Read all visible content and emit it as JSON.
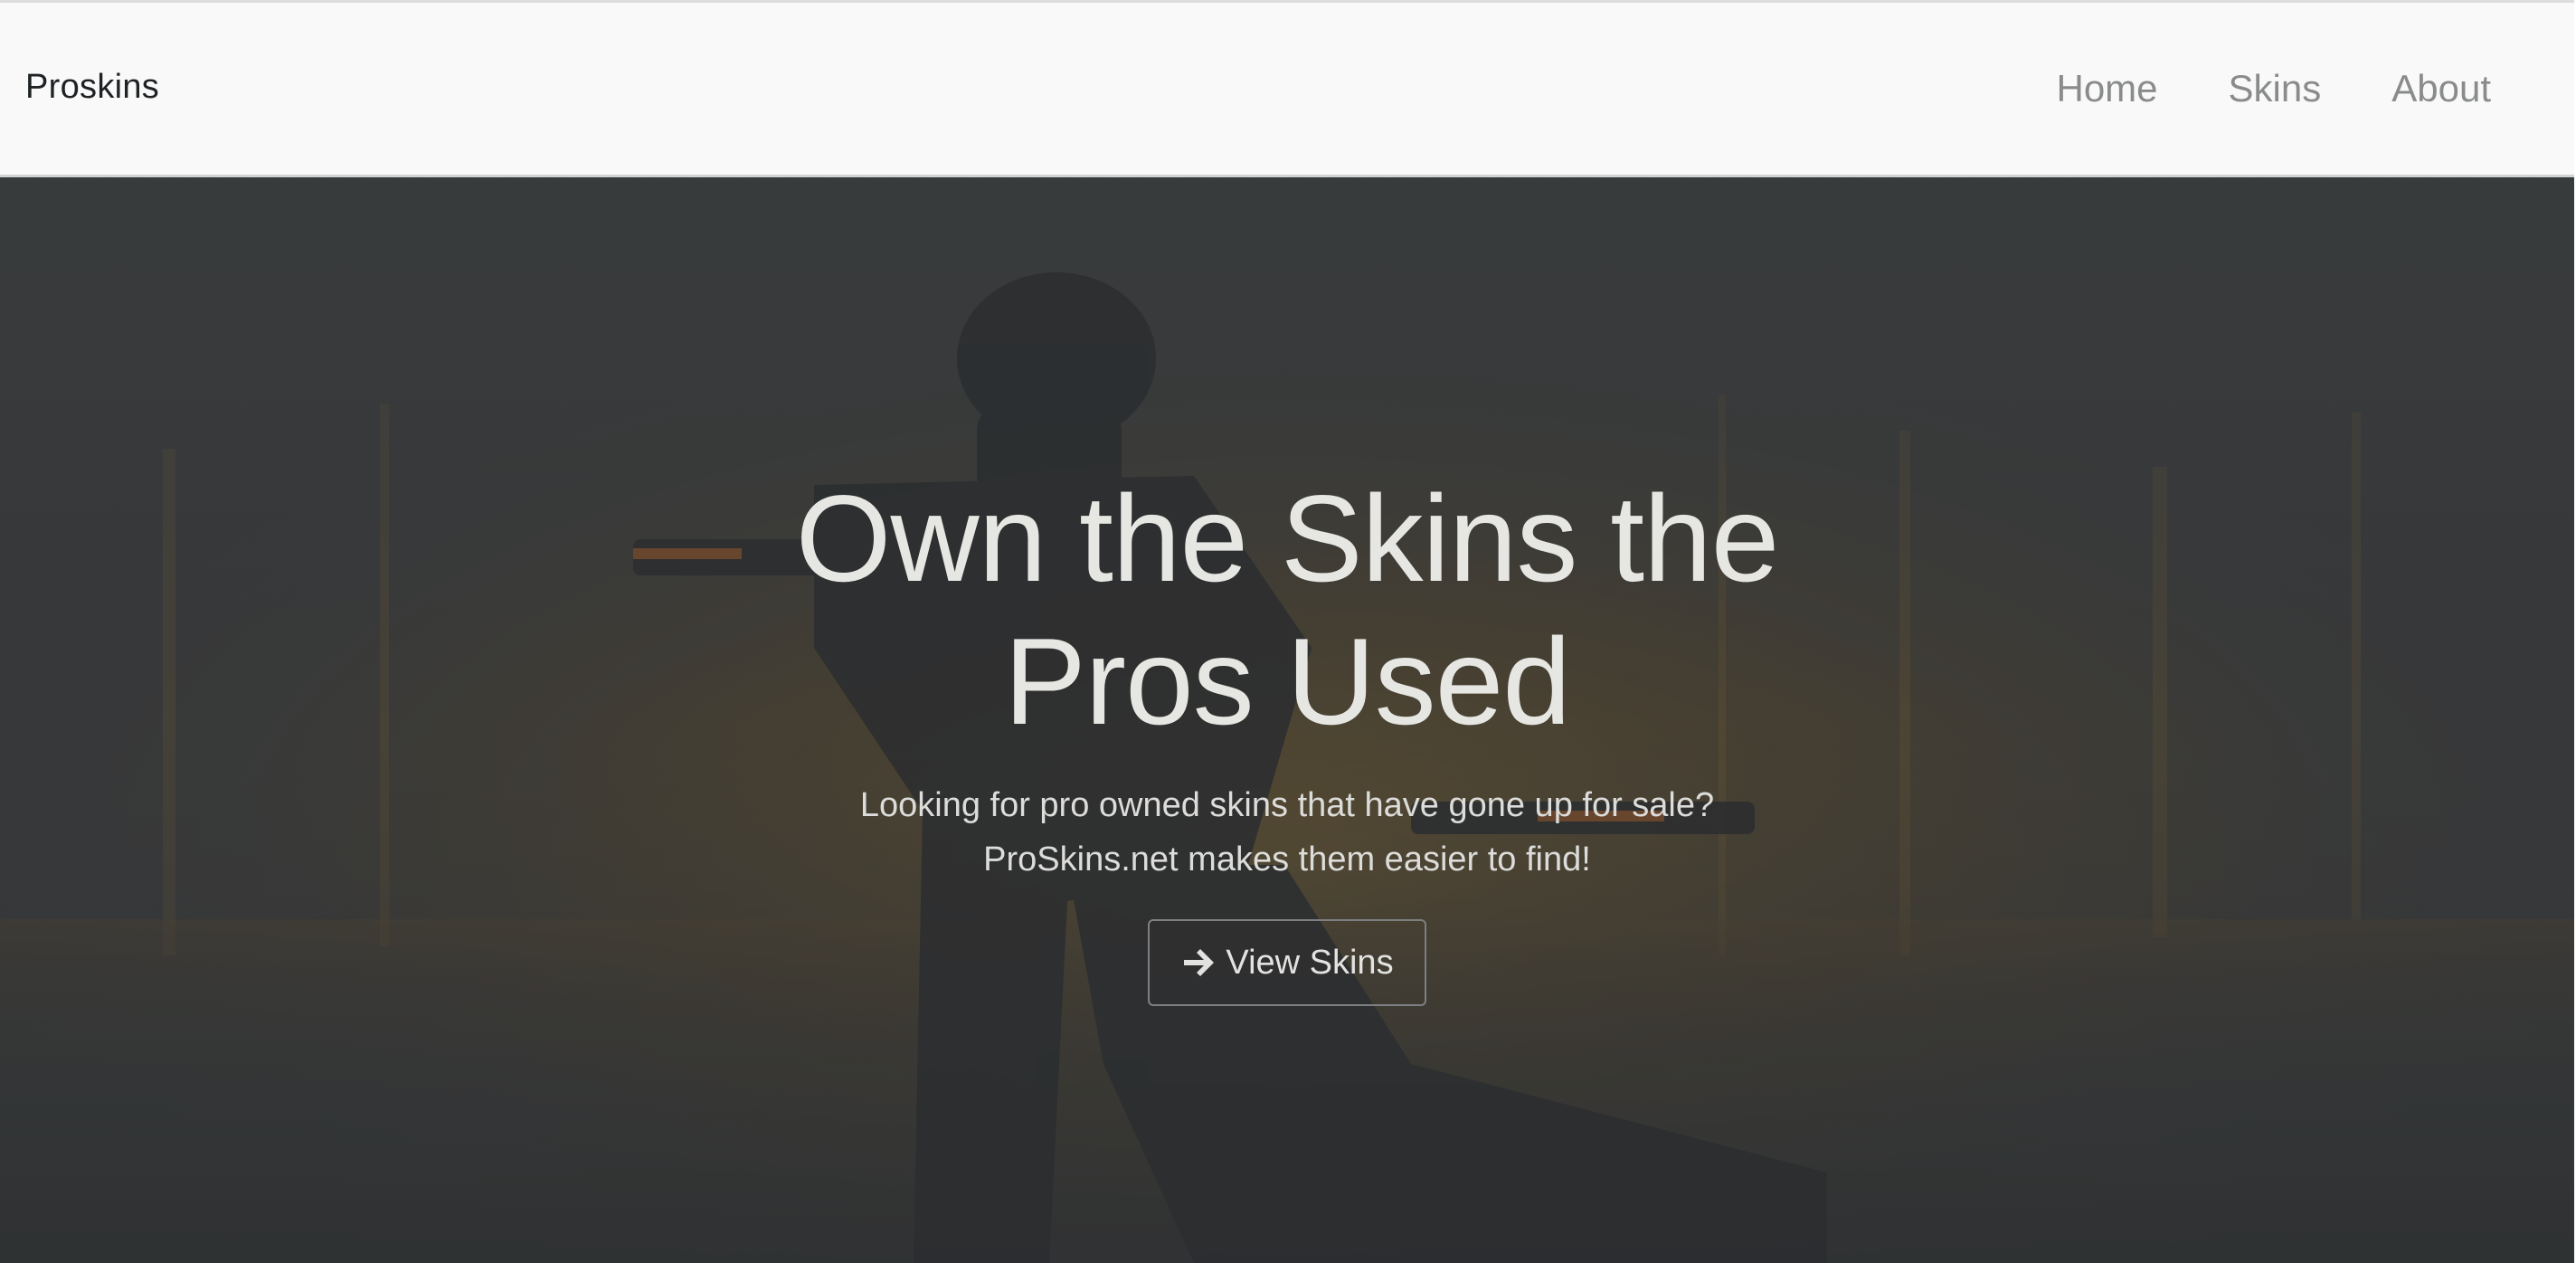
{
  "navbar": {
    "brand": "Proskins",
    "links": [
      {
        "label": "Home"
      },
      {
        "label": "Skins"
      },
      {
        "label": "About"
      }
    ]
  },
  "hero": {
    "title_line1": "Own the Skins the",
    "title_line2": "Pros Used",
    "subtitle_line1": "Looking for pro owned skins that have gone up for sale?",
    "subtitle_line2": "ProSkins.net makes them easier to find!",
    "cta_label": "View Skins",
    "cta_icon": "arrow-right-icon",
    "background_image": "soldier-silhouette-background"
  },
  "colors": {
    "navbar_bg": "#f8f9f8",
    "hero_overlay": "#353839",
    "accent_orange": "#b07a2a",
    "text_light": "#e6e6e2",
    "nav_link": "#8a8b8b"
  }
}
